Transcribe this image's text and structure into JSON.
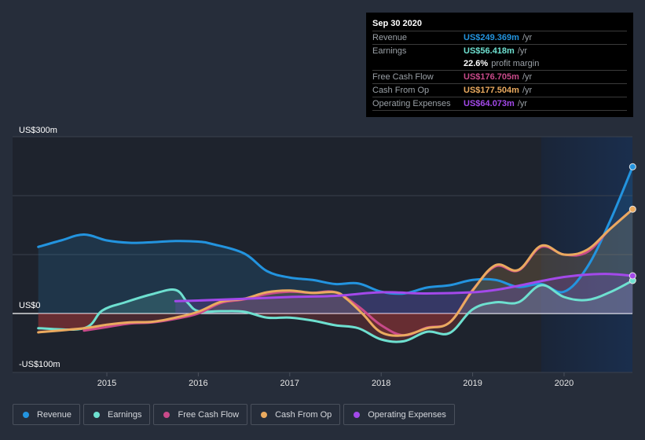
{
  "tooltip": {
    "date": "Sep 30 2020",
    "rows": [
      {
        "label": "Revenue",
        "value": "US$249.369m",
        "unit": "/yr",
        "color": "#2394df"
      },
      {
        "label": "Earnings",
        "value": "US$56.418m",
        "unit": "/yr",
        "color": "#6ee0d0"
      },
      {
        "label": "",
        "value": "22.6%",
        "unit": "profit margin",
        "color": "#ffffff"
      },
      {
        "label": "Free Cash Flow",
        "value": "US$176.705m",
        "unit": "/yr",
        "color": "#c94a8a"
      },
      {
        "label": "Cash From Op",
        "value": "US$177.504m",
        "unit": "/yr",
        "color": "#eaaa5f"
      },
      {
        "label": "Operating Expenses",
        "value": "US$64.073m",
        "unit": "/yr",
        "color": "#a349ea"
      }
    ]
  },
  "legend": [
    {
      "label": "Revenue",
      "color": "#2394df"
    },
    {
      "label": "Earnings",
      "color": "#6ee0d0"
    },
    {
      "label": "Free Cash Flow",
      "color": "#c94a8a"
    },
    {
      "label": "Cash From Op",
      "color": "#eaaa5f"
    },
    {
      "label": "Operating Expenses",
      "color": "#a349ea"
    }
  ],
  "chart_data": {
    "type": "line",
    "title": "",
    "xlabel": "",
    "ylabel": "",
    "ylim": [
      -100,
      300
    ],
    "xlim": [
      2014.25,
      2020.75
    ],
    "y_tick_labels": [
      {
        "value": 300,
        "label": "US$300m"
      },
      {
        "value": 0,
        "label": "US$0"
      },
      {
        "value": -100,
        "label": "-US$100m"
      }
    ],
    "y_gridlines": [
      300,
      200,
      100,
      0,
      -100
    ],
    "x_tick_labels": [
      {
        "value": 2015,
        "label": "2015"
      },
      {
        "value": 2016,
        "label": "2016"
      },
      {
        "value": 2017,
        "label": "2017"
      },
      {
        "value": 2018,
        "label": "2018"
      },
      {
        "value": 2019,
        "label": "2019"
      },
      {
        "value": 2020,
        "label": "2020"
      }
    ],
    "highlight_range": [
      2019.75,
      2020.75
    ],
    "legend_position": "bottom",
    "series": [
      {
        "name": "Revenue",
        "color": "#2394df",
        "fill": true,
        "end_marker": true,
        "x": [
          2014.25,
          2014.5,
          2014.75,
          2015.0,
          2015.25,
          2015.5,
          2015.75,
          2016.0,
          2016.15,
          2016.5,
          2016.75,
          2017.0,
          2017.25,
          2017.5,
          2017.75,
          2018.0,
          2018.25,
          2018.5,
          2018.75,
          2019.0,
          2019.25,
          2019.5,
          2019.75,
          2020.0,
          2020.25,
          2020.5,
          2020.75
        ],
        "y": [
          113,
          124,
          134,
          124,
          120,
          121,
          123,
          122,
          118,
          102,
          72,
          61,
          57,
          50,
          51,
          37,
          34,
          44,
          48,
          57,
          57,
          45,
          50,
          37,
          78,
          156,
          249
        ]
      },
      {
        "name": "Earnings",
        "color": "#6ee0d0",
        "fill": true,
        "end_marker": true,
        "x": [
          2014.25,
          2014.75,
          2014.95,
          2015.2,
          2015.5,
          2015.75,
          2015.88,
          2016.0,
          2016.25,
          2016.5,
          2016.75,
          2017.0,
          2017.25,
          2017.5,
          2017.75,
          2018.0,
          2018.25,
          2018.5,
          2018.75,
          2019.0,
          2019.25,
          2019.5,
          2019.75,
          2020.0,
          2020.25,
          2020.5,
          2020.75
        ],
        "y": [
          -25,
          -25,
          5,
          19,
          33,
          40,
          19,
          4,
          4,
          3,
          -7,
          -7,
          -12,
          -20,
          -25,
          -44,
          -47,
          -31,
          -33,
          7,
          19,
          19,
          48,
          28,
          23,
          36,
          56
        ]
      },
      {
        "name": "Free Cash Flow",
        "color": "#c94a8a",
        "fill": false,
        "end_marker": false,
        "x": [
          2014.75,
          2015.0,
          2015.25,
          2015.5,
          2015.75,
          2016.0,
          2016.25,
          2016.5,
          2016.75,
          2017.0,
          2017.25,
          2017.5,
          2017.75,
          2018.0,
          2018.25,
          2018.5,
          2018.75,
          2019.0,
          2019.25,
          2019.5,
          2019.75,
          2020.0,
          2020.25,
          2020.5,
          2020.75
        ],
        "y": [
          -29,
          -23,
          -17,
          -15,
          -9,
          0,
          18,
          24,
          33,
          37,
          35,
          36,
          12,
          -20,
          -37,
          -24,
          -15,
          40,
          80,
          73,
          113,
          100,
          104,
          143,
          177
        ]
      },
      {
        "name": "Cash From Op",
        "color": "#eaaa5f",
        "fill": true,
        "end_marker": true,
        "x": [
          2014.25,
          2014.75,
          2015.0,
          2015.25,
          2015.5,
          2015.75,
          2016.0,
          2016.25,
          2016.5,
          2016.75,
          2017.0,
          2017.25,
          2017.5,
          2017.62,
          2017.8,
          2018.0,
          2018.25,
          2018.5,
          2018.75,
          2019.0,
          2019.25,
          2019.5,
          2019.75,
          2020.0,
          2020.25,
          2020.5,
          2020.75
        ],
        "y": [
          -32,
          -25,
          -19,
          -15,
          -14,
          -7,
          3,
          20,
          25,
          36,
          39,
          35,
          36,
          25,
          -1,
          -32,
          -37,
          -25,
          -15,
          39,
          82,
          74,
          115,
          100,
          108,
          143,
          177
        ]
      },
      {
        "name": "Operating Expenses",
        "color": "#a349ea",
        "fill": true,
        "end_marker": true,
        "x": [
          2015.75,
          2016.0,
          2016.5,
          2017.0,
          2017.5,
          2018.0,
          2018.5,
          2019.0,
          2019.25,
          2019.5,
          2019.75,
          2020.0,
          2020.25,
          2020.5,
          2020.75
        ],
        "y": [
          21,
          22,
          25,
          28,
          30,
          36,
          34,
          36,
          40,
          47,
          55,
          62,
          66,
          67,
          64
        ]
      }
    ]
  }
}
